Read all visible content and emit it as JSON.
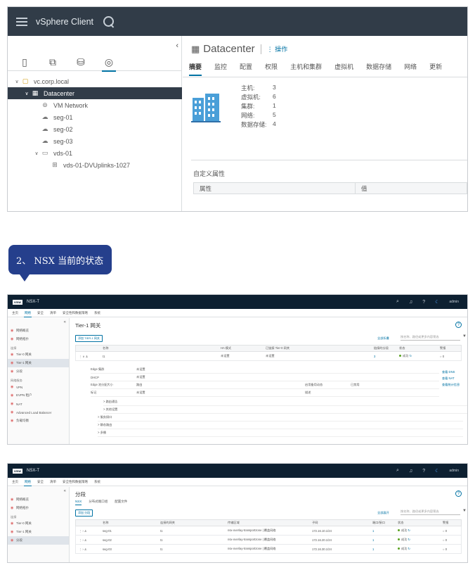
{
  "vsphere": {
    "app_title": "vSphere Client",
    "tree": [
      {
        "label": "vc.corp.local",
        "icon": "vcenter-icon",
        "level": 0
      },
      {
        "label": "Datacenter",
        "icon": "datacenter-icon",
        "level": 1
      },
      {
        "label": "VM Network",
        "icon": "network-icon",
        "level": 2
      },
      {
        "label": "seg-01",
        "icon": "segment-icon",
        "level": 2
      },
      {
        "label": "seg-02",
        "icon": "segment-icon",
        "level": 2
      },
      {
        "label": "seg-03",
        "icon": "segment-icon",
        "level": 2
      },
      {
        "label": "vds-01",
        "icon": "vds-icon",
        "level": 2
      },
      {
        "label": "vds-01-DVUplinks-1027",
        "icon": "uplink-icon",
        "level": 3
      }
    ],
    "object_title": "Datacenter",
    "actions_label": "操作",
    "tabs": [
      "摘要",
      "监控",
      "配置",
      "权限",
      "主机和集群",
      "虚拟机",
      "数据存储",
      "网络",
      "更新"
    ],
    "summary": [
      {
        "label": "主机:",
        "value": "3"
      },
      {
        "label": "虚拟机:",
        "value": "6"
      },
      {
        "label": "集群:",
        "value": "1"
      },
      {
        "label": "网络:",
        "value": "5"
      },
      {
        "label": "数据存储:",
        "value": "4"
      }
    ],
    "custom_attr_title": "自定义属性",
    "custom_attr_cols": [
      "属性",
      "值"
    ]
  },
  "callout": "2、 NSX 当前的状态",
  "nsx1": {
    "brand": "vmw",
    "title": "NSX-T",
    "user": "admin",
    "nav": [
      "主页",
      "网络",
      "安全",
      "清单",
      "安全性和数据策略",
      "系统"
    ],
    "side": [
      {
        "type": "item",
        "label": "网络概览"
      },
      {
        "type": "item",
        "label": "网络拓扑"
      },
      {
        "type": "group",
        "label": "连接"
      },
      {
        "type": "item",
        "label": "Tier-0 网关"
      },
      {
        "type": "item",
        "label": "Tier-1 网关",
        "selected": true
      },
      {
        "type": "item",
        "label": "分段"
      },
      {
        "type": "group",
        "label": "网络服务"
      },
      {
        "type": "item",
        "label": "VPN"
      },
      {
        "type": "item",
        "label": "EVPN 租户"
      },
      {
        "type": "item",
        "label": "NAT"
      },
      {
        "type": "item",
        "label": "Advanced Load Balancer"
      },
      {
        "type": "item",
        "label": "负载均衡"
      }
    ],
    "page_title": "Tier-1 网关",
    "add_button": "添加 TIER-1 网关",
    "expand_all": "全部折叠",
    "filter_placeholder": "按名称、路径或更多内容筛选",
    "columns": [
      "名称",
      "HA 模式",
      "已链接 Tier-0 网关",
      "链接的分段",
      "状态",
      "警报"
    ],
    "row": {
      "name": "t1",
      "ha": "未设置",
      "t0": "未设置",
      "segments": "3",
      "status": "成功",
      "alarms": "0"
    },
    "details": [
      {
        "k": "Edge 集群",
        "v": "未设置",
        "k2": "",
        "v2": ""
      },
      {
        "k": "DHCP",
        "v": "未设置",
        "k2": "",
        "v2": ""
      },
      {
        "k": "Edge 池分配大小",
        "v": "路由",
        "k2": "启用备用动态",
        "v2": "已禁用"
      },
      {
        "k": "标记",
        "v": "未设置",
        "k2": "描述",
        "v2": ""
      }
    ],
    "expanders": [
      "> 路由通告",
      "> 其他设置",
      "> 服务接口",
      "> 静态路由",
      "> 多播"
    ],
    "side_links": [
      "查看 DNS",
      "查看 NAT",
      "查看统计信息"
    ]
  },
  "nsx2": {
    "brand": "vmw",
    "title": "NSX-T",
    "user": "admin",
    "nav": [
      "主页",
      "网络",
      "安全",
      "清单",
      "安全性和数据策略",
      "系统"
    ],
    "side": [
      {
        "type": "item",
        "label": "网络概览"
      },
      {
        "type": "item",
        "label": "网络拓扑"
      },
      {
        "type": "group",
        "label": "连接"
      },
      {
        "type": "item",
        "label": "Tier-0 网关"
      },
      {
        "type": "item",
        "label": "Tier-1 网关"
      },
      {
        "type": "item",
        "label": "分段",
        "selected": true
      }
    ],
    "page_title": "分段",
    "subtabs": [
      "NSX",
      "分布式端口组",
      "配置文件"
    ],
    "add_button": "添加 分段",
    "expand_all": "全部展开",
    "filter_placeholder": "按名称、路径或更多内容筛选",
    "columns": [
      "名称",
      "连接的网关",
      "传输区域",
      "子网",
      "端口/接口",
      "状态",
      "警报"
    ],
    "rows": [
      {
        "name": "seg-01",
        "gw": "t1",
        "tz": "nsx-overlay-transportzone | 覆盖网络",
        "subnet": "172.16.10.1/24",
        "ports": "1",
        "status": "成功",
        "alarms": "0"
      },
      {
        "name": "seg-02",
        "gw": "t1",
        "tz": "nsx-overlay-transportzone | 覆盖网络",
        "subnet": "172.16.20.1/24",
        "ports": "1",
        "status": "成功",
        "alarms": "0"
      },
      {
        "name": "seg-03",
        "gw": "t1",
        "tz": "nsx-overlay-transportzone | 覆盖网络",
        "subnet": "172.16.30.1/24",
        "ports": "1",
        "status": "成功",
        "alarms": "0"
      }
    ]
  }
}
